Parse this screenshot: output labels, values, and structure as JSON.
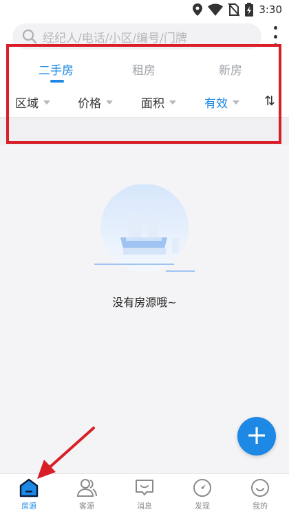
{
  "status_bar": {
    "time": "3:30"
  },
  "search": {
    "placeholder": "经纪人/电话/小区/编号/门牌"
  },
  "tabs": [
    {
      "label": "二手房",
      "active": true
    },
    {
      "label": "租房",
      "active": false
    },
    {
      "label": "新房",
      "active": false
    }
  ],
  "filters": [
    {
      "label": "区域",
      "active": false
    },
    {
      "label": "价格",
      "active": false
    },
    {
      "label": "面积",
      "active": false
    },
    {
      "label": "有效",
      "active": true
    }
  ],
  "sort_icon": "⇅",
  "empty_state": {
    "message": "没有房源哦~"
  },
  "fab": {
    "icon": "+"
  },
  "bottom_nav": [
    {
      "label": "房源",
      "icon": "house-icon",
      "active": true
    },
    {
      "label": "客源",
      "icon": "people-icon",
      "active": false
    },
    {
      "label": "消息",
      "icon": "message-icon",
      "active": false
    },
    {
      "label": "发现",
      "icon": "compass-icon",
      "active": false
    },
    {
      "label": "我的",
      "icon": "smiley-icon",
      "active": false
    }
  ],
  "colors": {
    "accent": "#1e88e5",
    "annotation": "#d81e27"
  }
}
